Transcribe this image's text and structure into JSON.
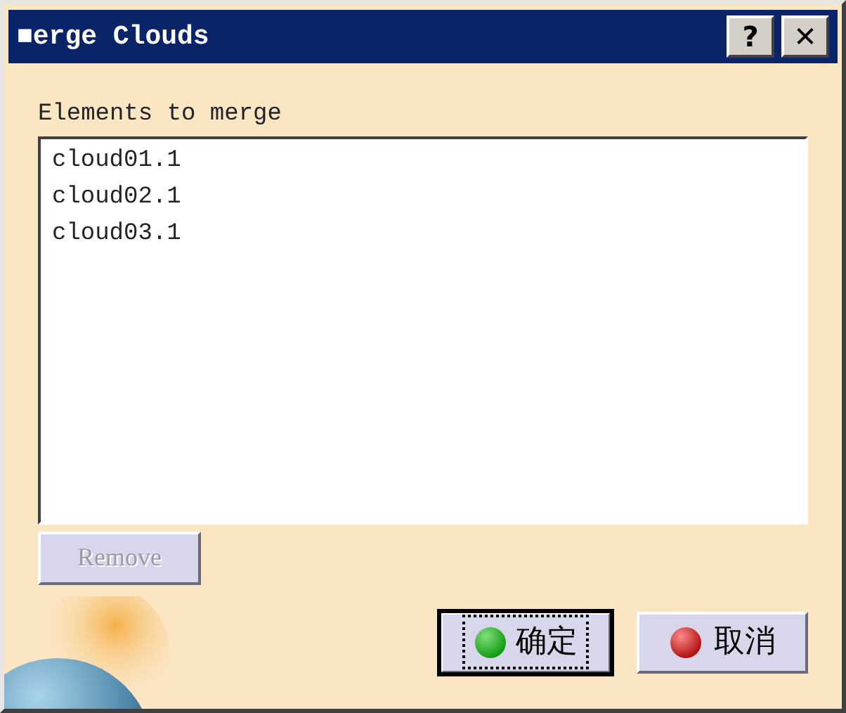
{
  "window": {
    "title": "■erge Clouds",
    "title_buttons": [
      "?",
      "✕"
    ]
  },
  "elements_label": "Elements to merge",
  "elements": [
    {
      "name": "cloud01.1"
    },
    {
      "name": "cloud02.1"
    },
    {
      "name": "cloud03.1"
    }
  ],
  "remove_button": {
    "label": "Remove",
    "disabled": true
  },
  "buttons": [
    {
      "label": "确定",
      "kind": "ok",
      "default": true
    },
    {
      "label": "取消",
      "kind": "cancel",
      "default": false
    }
  ]
}
